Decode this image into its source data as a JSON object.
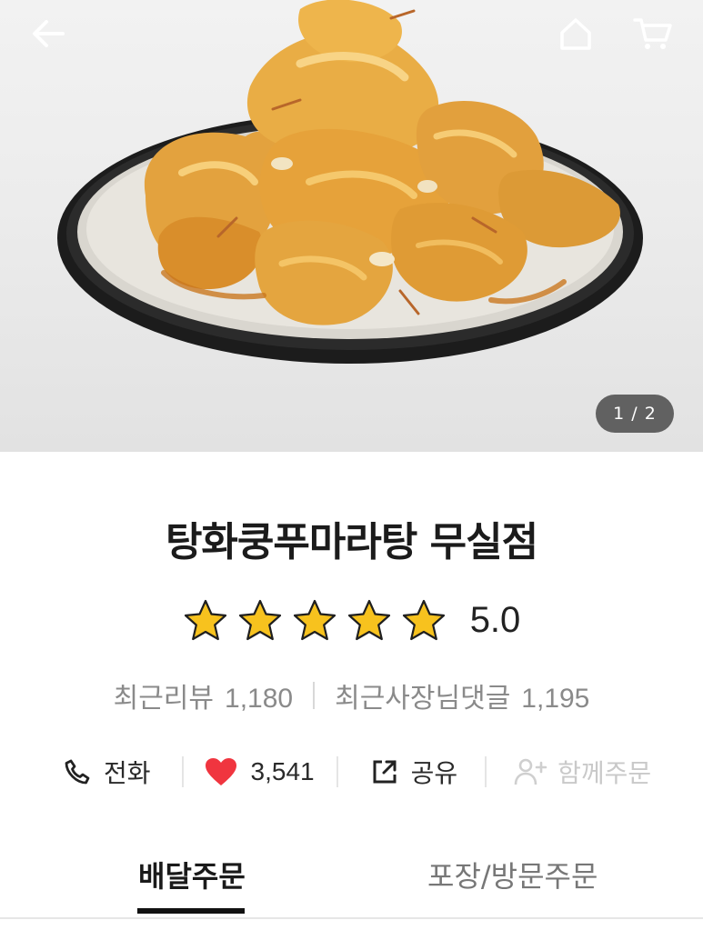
{
  "header": {
    "back_icon": "arrow-left-icon",
    "home_icon": "home-icon",
    "cart_icon": "cart-icon",
    "image_pager": "1 / 2"
  },
  "store": {
    "name": "탕화쿵푸마라탕 무실점",
    "rating": "5.0",
    "rating_stars": 5,
    "recent_reviews_label": "최근리뷰",
    "recent_reviews_count": "1,180",
    "owner_replies_label": "최근사장님댓글",
    "owner_replies_count": "1,195"
  },
  "actions": {
    "call_label": "전화",
    "like_count": "3,541",
    "share_label": "공유",
    "group_order_label": "함께주문"
  },
  "tabs": {
    "delivery_label": "배달주문",
    "pickup_label": "포장/방문주문"
  },
  "colors": {
    "heart": "#f0353f",
    "star": "#f7c21e",
    "active_tab": "#111111"
  }
}
